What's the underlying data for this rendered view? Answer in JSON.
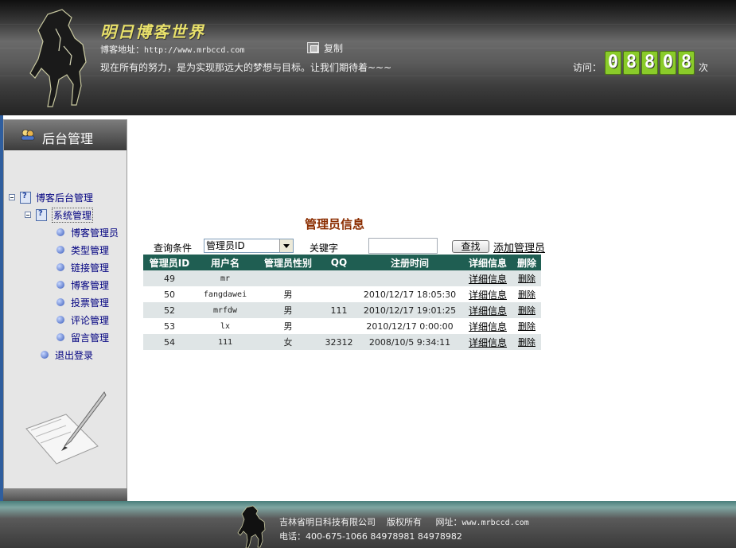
{
  "header": {
    "blog_title": "明日博客世界",
    "url_label": "博客地址：",
    "url_value": "http://www.mrbccd.com",
    "copy_label": "复制",
    "slogan": "现在所有的努力，是为实现那远大的梦想与目标。让我们期待着~~~",
    "visits_label": "访问：",
    "visit_digits": [
      "0",
      "8",
      "8",
      "0",
      "8"
    ],
    "visits_unit": "次"
  },
  "sidebar": {
    "title": "后台管理",
    "root": "博客后台管理",
    "system": "系统管理",
    "items": [
      "博客管理员",
      "类型管理",
      "链接管理",
      "博客管理",
      "投票管理",
      "评论管理",
      "留言管理"
    ],
    "logout": "退出登录"
  },
  "main": {
    "title": "管理员信息",
    "query_label": "查询条件",
    "query_selected": "管理员ID",
    "keyword_label": "关键字",
    "search_button": "查找",
    "add_link": "添加管理员"
  },
  "table": {
    "columns": [
      "管理员ID",
      "用户名",
      "管理员性别",
      "QQ",
      "注册时间",
      "详细信息",
      "删除"
    ],
    "rows": [
      {
        "id": "49",
        "username": "mr",
        "gender": "",
        "qq": "",
        "reg_time": "",
        "detail": "详细信息",
        "delete": "删除"
      },
      {
        "id": "50",
        "username": "fangdawei",
        "gender": "男",
        "qq": "",
        "reg_time": "2010/12/17 18:05:30",
        "detail": "详细信息",
        "delete": "删除"
      },
      {
        "id": "52",
        "username": "mrfdw",
        "gender": "男",
        "qq": "111",
        "reg_time": "2010/12/17 19:01:25",
        "detail": "详细信息",
        "delete": "删除"
      },
      {
        "id": "53",
        "username": "lx",
        "gender": "男",
        "qq": "",
        "reg_time": "2010/12/17 0:00:00",
        "detail": "详细信息",
        "delete": "删除"
      },
      {
        "id": "54",
        "username": "111",
        "gender": "女",
        "qq": "32312",
        "reg_time": "2008/10/5 9:34:11",
        "detail": "详细信息",
        "delete": "删除"
      }
    ]
  },
  "footer": {
    "company": "吉林省明日科技有限公司",
    "rights": "版权所有",
    "site_label": "网址：",
    "site_value": "www.mrbccd.com",
    "phone_label": "电话：",
    "phone_value": "400-675-1066  84978981 84978982"
  },
  "colors": {
    "table_header": "#1f5e52",
    "title_red": "#8b2d00",
    "counter_green": "#8acb2a",
    "tree_link": "#000080"
  },
  "icons": [
    "horse-logo-icon",
    "copy-icon",
    "admin-manager-icon",
    "book-icon",
    "doc-icon",
    "quill-icon"
  ]
}
